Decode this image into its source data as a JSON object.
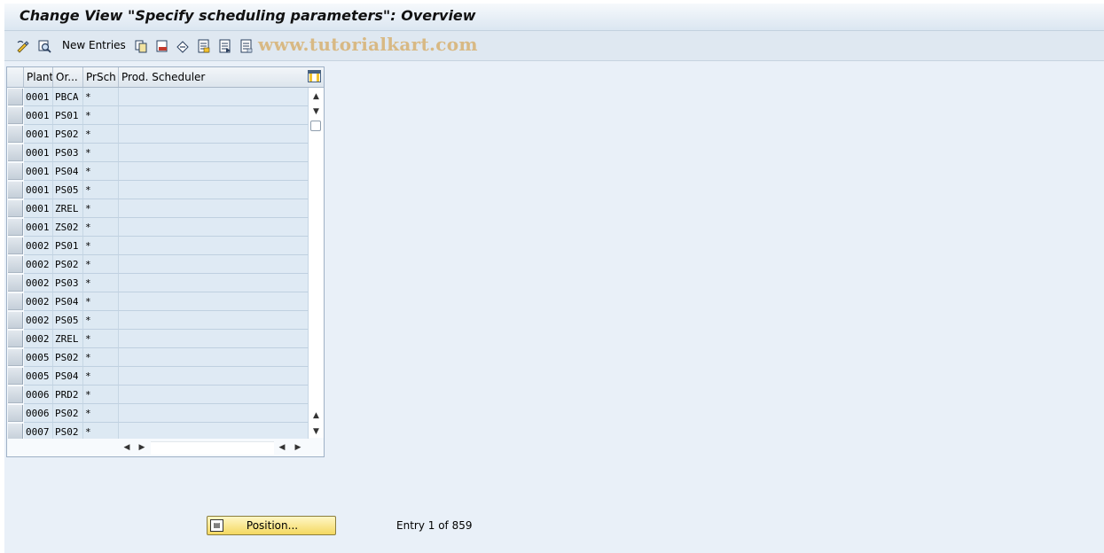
{
  "window": {
    "title": "Change View \"Specify scheduling parameters\": Overview"
  },
  "toolbar": {
    "new_entries_label": "New Entries",
    "watermark": "www.tutorialkart.com"
  },
  "table": {
    "columns": [
      "Plant",
      "Or...",
      "PrSch",
      "Prod. Scheduler"
    ],
    "rows": [
      {
        "plant": "0001",
        "order_type": "PBCA",
        "prsch": "*",
        "scheduler": ""
      },
      {
        "plant": "0001",
        "order_type": "PS01",
        "prsch": "*",
        "scheduler": ""
      },
      {
        "plant": "0001",
        "order_type": "PS02",
        "prsch": "*",
        "scheduler": ""
      },
      {
        "plant": "0001",
        "order_type": "PS03",
        "prsch": "*",
        "scheduler": ""
      },
      {
        "plant": "0001",
        "order_type": "PS04",
        "prsch": "*",
        "scheduler": ""
      },
      {
        "plant": "0001",
        "order_type": "PS05",
        "prsch": "*",
        "scheduler": ""
      },
      {
        "plant": "0001",
        "order_type": "ZREL",
        "prsch": "*",
        "scheduler": ""
      },
      {
        "plant": "0001",
        "order_type": "ZS02",
        "prsch": "*",
        "scheduler": ""
      },
      {
        "plant": "0002",
        "order_type": "PS01",
        "prsch": "*",
        "scheduler": ""
      },
      {
        "plant": "0002",
        "order_type": "PS02",
        "prsch": "*",
        "scheduler": ""
      },
      {
        "plant": "0002",
        "order_type": "PS03",
        "prsch": "*",
        "scheduler": ""
      },
      {
        "plant": "0002",
        "order_type": "PS04",
        "prsch": "*",
        "scheduler": ""
      },
      {
        "plant": "0002",
        "order_type": "PS05",
        "prsch": "*",
        "scheduler": ""
      },
      {
        "plant": "0002",
        "order_type": "ZREL",
        "prsch": "*",
        "scheduler": ""
      },
      {
        "plant": "0005",
        "order_type": "PS02",
        "prsch": "*",
        "scheduler": ""
      },
      {
        "plant": "0005",
        "order_type": "PS04",
        "prsch": "*",
        "scheduler": ""
      },
      {
        "plant": "0006",
        "order_type": "PRD2",
        "prsch": "*",
        "scheduler": ""
      },
      {
        "plant": "0006",
        "order_type": "PS02",
        "prsch": "*",
        "scheduler": ""
      },
      {
        "plant": "0007",
        "order_type": "PS02",
        "prsch": "*",
        "scheduler": ""
      }
    ]
  },
  "footer": {
    "position_button_label": "Position...",
    "entry_text": "Entry 1 of 859"
  },
  "colors": {
    "screen_bg": "#e9f0f8",
    "cell_bg": "#dde9f3",
    "button_yellow": "#f4d860"
  }
}
